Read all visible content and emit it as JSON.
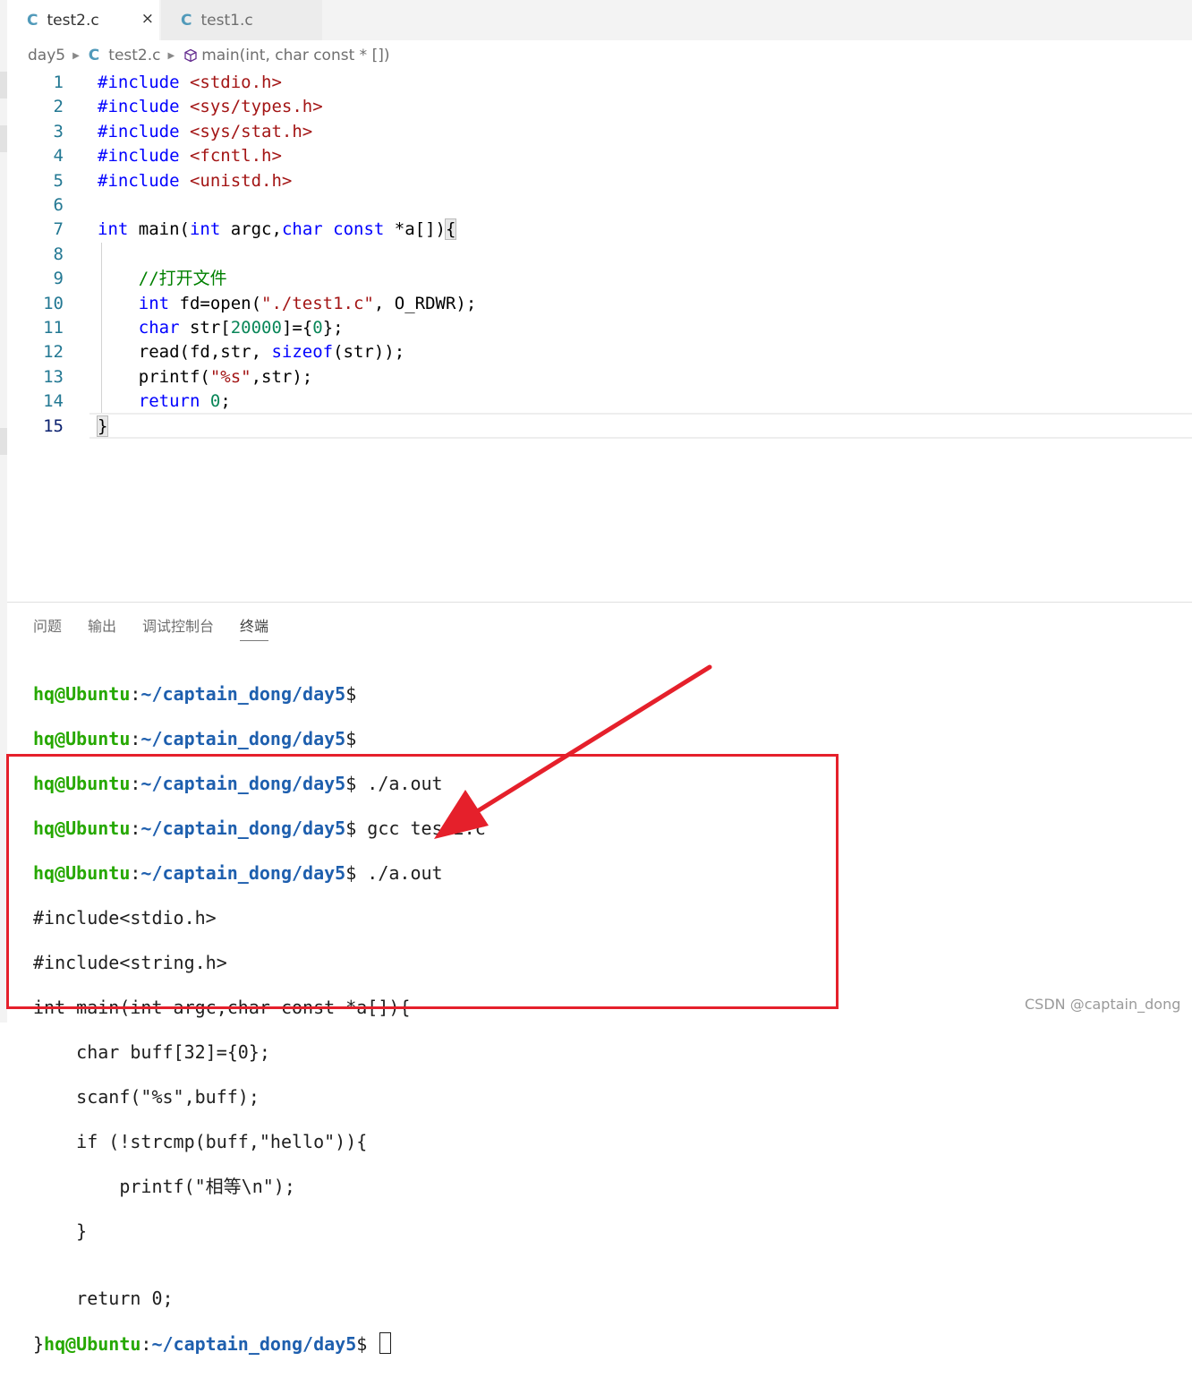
{
  "tabs": [
    {
      "icon": "C",
      "label": "test2.c",
      "close": "×"
    },
    {
      "icon": "C",
      "label": "test1.c"
    }
  ],
  "breadcrumb": {
    "folder": "day5",
    "file_icon": "C",
    "file": "test2.c",
    "symbol": "main(int, char const * [])"
  },
  "editor": {
    "line_numbers": [
      "1",
      "2",
      "3",
      "4",
      "5",
      "6",
      "7",
      "8",
      "9",
      "10",
      "11",
      "12",
      "13",
      "14",
      "15"
    ],
    "current_line": "15"
  },
  "panel": {
    "tabs": [
      "问题",
      "输出",
      "调试控制台",
      "终端"
    ],
    "active_tab": "终端"
  },
  "terminal": {
    "user": "hq@Ubuntu",
    "path": "~/captain_dong/day5",
    "prompt_lines": [
      {
        "cmd": ""
      },
      {
        "cmd": ""
      },
      {
        "cmd": " ./a.out"
      },
      {
        "cmd": " gcc test2.c"
      },
      {
        "cmd": " ./a.out"
      }
    ],
    "output_lines": [
      "#include<stdio.h>",
      "#include<string.h>",
      "int main(int argc,char const *a[]){",
      "    char buff[32]={0};",
      "    scanf(\"%s\",buff);",
      "    if (!strcmp(buff,\"hello\")){",
      "        printf(\"相等\\n\");",
      "    }",
      "",
      "    return 0;"
    ],
    "last_line_prefix": "}"
  },
  "annotation": {
    "color": "#e5202b"
  },
  "watermark": "CSDN @captain_dong"
}
